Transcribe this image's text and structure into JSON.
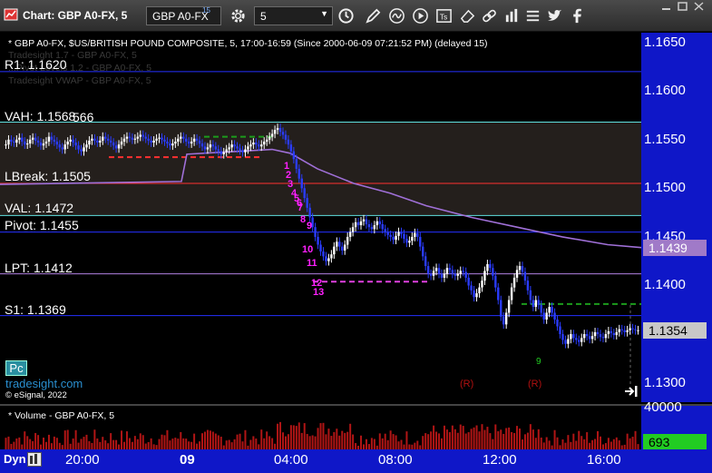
{
  "title_bar": {
    "title": "Chart: GBP A0-FX, 5",
    "symbol": "GBP A0-FX",
    "symbol_superscript": "15",
    "interval": "5"
  },
  "icons": [
    "gear-icon",
    "clock-icon",
    "pencil-icon",
    "wave-icon",
    "play-icon",
    "text-box-icon",
    "eraser-icon",
    "link-icon",
    "bars-icon",
    "twitter-icon",
    "facebook-icon"
  ],
  "chart": {
    "header": "* GBP A0-FX, $US/BRITISH POUND COMPOSITE, 5, 17:00-16:59 (Since 2000-06-09 07:21:52 PM) (delayed 15)",
    "faded_lines": [
      "Tradesight 1.7 - GBP A0-FX, 5",
      "...Pivot Levels 1.2 - GBP A0-FX, 5",
      "Tradesight VWAP - GBP A0-FX, 5"
    ],
    "levels": [
      {
        "name": "R1",
        "label": "R1: 1.1620",
        "value": 1.162,
        "color": "#2430ff"
      },
      {
        "name": "VAH",
        "label": "VAH: 1.1568",
        "value": 1.1568,
        "color": "#5fe0e0",
        "overlap": "566"
      },
      {
        "name": "LBreak",
        "label": "LBreak: 1.1505",
        "value": 1.1505,
        "color": "#ff3030"
      },
      {
        "name": "VAL",
        "label": "VAL: 1.1472",
        "value": 1.1472,
        "color": "#5fe0e0"
      },
      {
        "name": "Pivot",
        "label": "Pivot: 1.1455",
        "value": 1.1455,
        "color": "#2430ff"
      },
      {
        "name": "LPT",
        "label": "LPT: 1.1412",
        "value": 1.1412,
        "color": "#b080e0"
      },
      {
        "name": "S1",
        "label": "S1: 1.1369",
        "value": 1.1369,
        "color": "#2430ff"
      }
    ],
    "y_ticks": [
      "1.1650",
      "1.1600",
      "1.1550",
      "1.1500",
      "1.1450",
      "1.1400",
      "1.1350",
      "1.1300"
    ],
    "current_vwap": "1.1439",
    "current_price": "1.1354",
    "markers": [
      "1",
      "2",
      "3",
      "4",
      "5",
      "6",
      "7",
      "8",
      "9",
      "10",
      "11",
      "12",
      "13",
      "9",
      "(R)",
      "(R)"
    ],
    "badge": "Pc",
    "brand": "tradesight.com",
    "copyright": "© eSignal, 2022"
  },
  "volume": {
    "header": "* Volume - GBP A0-FX, 5",
    "y_tick": "40000",
    "current": "693"
  },
  "x_axis": {
    "mode": "Dyn",
    "labels": [
      "20:00",
      "09",
      "04:00",
      "08:00",
      "12:00",
      "16:00"
    ]
  },
  "chart_data": {
    "type": "candlestick",
    "y_range": [
      1.128,
      1.166
    ],
    "closes": [
      1.1545,
      1.155,
      1.1548,
      1.1547,
      1.155,
      1.1552,
      1.1548,
      1.1545,
      1.1546,
      1.155,
      1.1552,
      1.1549,
      1.1547,
      1.1544,
      1.1546,
      1.1548,
      1.1553,
      1.155,
      1.1548,
      1.1545,
      1.1542,
      1.154,
      1.1545,
      1.1548,
      1.155,
      1.1547,
      1.1544,
      1.154,
      1.1538,
      1.1542,
      1.1545,
      1.1549,
      1.1551,
      1.1549,
      1.1547,
      1.1549,
      1.1553,
      1.1551,
      1.1549,
      1.1547,
      1.1544,
      1.1541,
      1.1545,
      1.1548,
      1.1551,
      1.1553,
      1.1552,
      1.155,
      1.1551,
      1.1553,
      1.1555,
      1.1553,
      1.1551,
      1.1549,
      1.1547,
      1.1549,
      1.1551,
      1.1552,
      1.155,
      1.1548,
      1.1546,
      1.1544,
      1.1546,
      1.1548,
      1.1551,
      1.1553,
      1.1551,
      1.1548,
      1.1546,
      1.1548,
      1.1551,
      1.1549,
      1.1546,
      1.1543,
      1.154,
      1.1542,
      1.1545,
      1.1543,
      1.154,
      1.1538,
      1.1535,
      1.1537,
      1.154,
      1.1542,
      1.1545,
      1.1543,
      1.1541,
      1.1539,
      1.1537,
      1.154,
      1.1543,
      1.1545,
      1.1547,
      1.1545,
      1.1543,
      1.1545,
      1.1548,
      1.155,
      1.1553,
      1.1556,
      1.156,
      1.1562,
      1.1558,
      1.1555,
      1.155,
      1.1545,
      1.1538,
      1.153,
      1.152,
      1.151,
      1.15,
      1.149,
      1.148,
      1.147,
      1.146,
      1.145,
      1.1442,
      1.1435,
      1.143,
      1.1425,
      1.1428,
      1.1432,
      1.144,
      1.1445,
      1.144,
      1.1436,
      1.1442,
      1.145,
      1.1455,
      1.146,
      1.1465,
      1.1462,
      1.1466,
      1.1468,
      1.1463,
      1.146,
      1.1458,
      1.1462,
      1.1466,
      1.1463,
      1.1458,
      1.1455,
      1.1452,
      1.145,
      1.1447,
      1.1451,
      1.1455,
      1.1453,
      1.1448,
      1.1444,
      1.1446,
      1.145,
      1.1454,
      1.145,
      1.144,
      1.143,
      1.142,
      1.1412,
      1.141,
      1.1415,
      1.1418,
      1.1412,
      1.1408,
      1.1412,
      1.1418,
      1.1416,
      1.1412,
      1.141,
      1.1412,
      1.1415,
      1.1414,
      1.1408,
      1.14,
      1.1395,
      1.1388,
      1.1392,
      1.1398,
      1.1405,
      1.1415,
      1.1422,
      1.1418,
      1.141,
      1.1398,
      1.1385,
      1.1368,
      1.136,
      1.1372,
      1.1385,
      1.1398,
      1.1408,
      1.1416,
      1.142,
      1.1414,
      1.1405,
      1.1395,
      1.1385,
      1.1378,
      1.1385,
      1.138,
      1.1372,
      1.1365,
      1.1372,
      1.1378,
      1.1372,
      1.1365,
      1.1358,
      1.135,
      1.1344,
      1.134,
      1.1345,
      1.135,
      1.1346,
      1.1344,
      1.1342,
      1.1346,
      1.135,
      1.1348,
      1.1345,
      1.1348,
      1.1352,
      1.135,
      1.1347,
      1.1346,
      1.135,
      1.1353,
      1.1351,
      1.1349,
      1.1352,
      1.1355,
      1.1354,
      1.1352,
      1.1354,
      1.1356,
      1.1355,
      1.1354,
      1.1354
    ]
  }
}
